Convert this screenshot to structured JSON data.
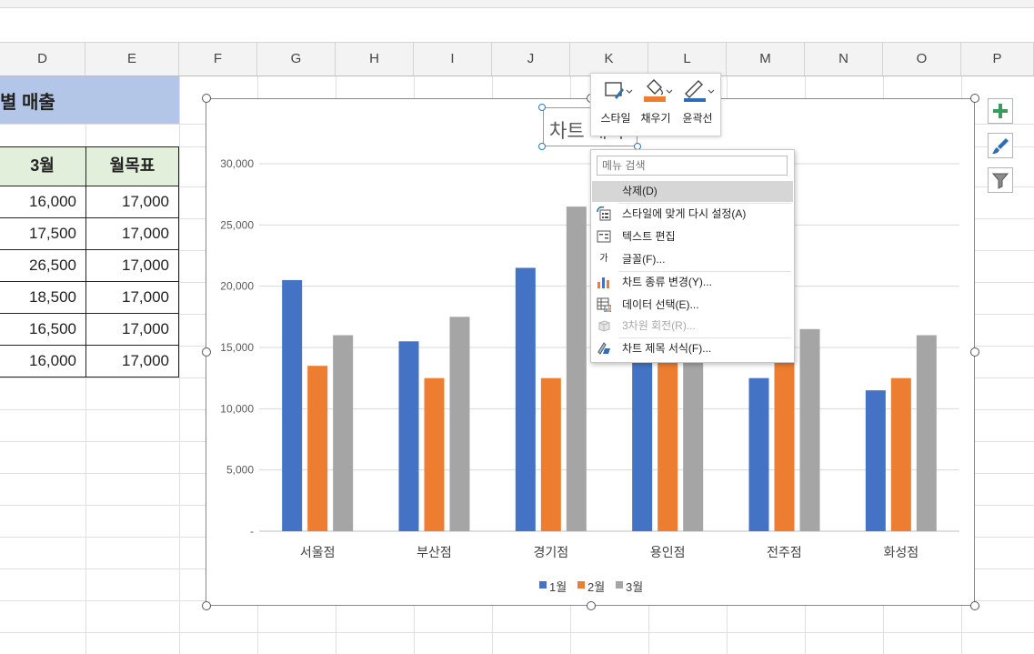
{
  "columns": [
    "D",
    "E",
    "F",
    "G",
    "H",
    "I",
    "J",
    "K",
    "L",
    "M",
    "N",
    "O",
    "P"
  ],
  "sheet": {
    "title_fragment": "별 매출",
    "table_headers": [
      "3월",
      "월목표"
    ],
    "rows": [
      [
        "16,000",
        "17,000"
      ],
      [
        "17,500",
        "17,000"
      ],
      [
        "26,500",
        "17,000"
      ],
      [
        "18,500",
        "17,000"
      ],
      [
        "16,500",
        "17,000"
      ],
      [
        "16,000",
        "17,000"
      ]
    ]
  },
  "chart_data": {
    "type": "bar",
    "title": "차트 제목",
    "categories": [
      "서울점",
      "부산점",
      "경기점",
      "용인점",
      "전주점",
      "화성점"
    ],
    "series": [
      {
        "name": "1월",
        "color": "#4472C4",
        "values": [
          20500,
          15500,
          21500,
          14000,
          12500,
          11500
        ]
      },
      {
        "name": "2월",
        "color": "#ED7D31",
        "values": [
          13500,
          12500,
          12500,
          14000,
          15500,
          12500
        ]
      },
      {
        "name": "3월",
        "color": "#A5A5A5",
        "values": [
          16000,
          17500,
          26500,
          18500,
          16500,
          16000
        ]
      }
    ],
    "ylim": [
      0,
      30000
    ],
    "yticks": [
      "-",
      "5,000",
      "10,000",
      "15,000",
      "20,000",
      "25,000",
      "30,000"
    ],
    "grid": true,
    "legend": "bottom"
  },
  "chart_tools": {
    "plus_icon": "chart-elements-icon",
    "brush_icon": "chart-styles-icon",
    "filter_icon": "chart-filters-icon"
  },
  "mini_toolbar": {
    "style_label": "스타일",
    "fill_label": "채우기",
    "outline_label": "윤곽선"
  },
  "context_menu": {
    "search_placeholder": "메뉴 검색",
    "items": [
      {
        "label": "삭제(D)",
        "icon": "none",
        "selected": true
      },
      {
        "label": "스타일에 맞게 다시 설정(A)",
        "icon": "reset-style-icon"
      },
      {
        "label": "텍스트 편집",
        "icon": "edit-text-icon"
      },
      {
        "label": "글꼴(F)...",
        "icon": "font-icon"
      },
      {
        "label": "차트 종류 변경(Y)...",
        "icon": "chart-type-icon"
      },
      {
        "label": "데이터 선택(E)...",
        "icon": "select-data-icon"
      },
      {
        "label": "3차원 회전(R)...",
        "icon": "3d-rotation-icon",
        "disabled": true
      },
      {
        "label": "차트 제목 서식(F)...",
        "icon": "format-title-icon"
      }
    ]
  },
  "font_icon_glyph": "가"
}
